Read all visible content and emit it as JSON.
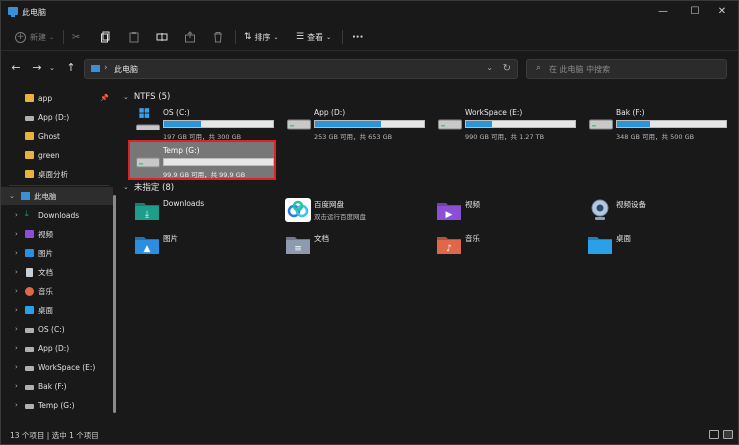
{
  "window": {
    "title": "此电脑"
  },
  "toolbar": {
    "new_label": "新建",
    "sort_label": "排序",
    "view_label": "查看",
    "more_label": "···"
  },
  "nav": {
    "back": "←",
    "forward": "→",
    "up": "↑",
    "path": "此电脑"
  },
  "search": {
    "placeholder": "在 此电脑 中搜索"
  },
  "sidebar": {
    "quick_access": [
      {
        "label": "app",
        "icon": "folder-icon",
        "pinned": true
      },
      {
        "label": "App (D:)",
        "icon": "drive-icon"
      },
      {
        "label": "Ghost",
        "icon": "folder-icon"
      },
      {
        "label": "green",
        "icon": "folder-icon"
      },
      {
        "label": "桌面分析",
        "icon": "folder-icon"
      }
    ],
    "this_pc": {
      "label": "此电脑"
    },
    "pc_items": [
      {
        "label": "Downloads",
        "icon": "download-icon"
      },
      {
        "label": "视频",
        "icon": "video-icon"
      },
      {
        "label": "图片",
        "icon": "picture-icon"
      },
      {
        "label": "文档",
        "icon": "document-icon"
      },
      {
        "label": "音乐",
        "icon": "music-icon"
      },
      {
        "label": "桌面",
        "icon": "desktop-icon"
      },
      {
        "label": "OS (C:)",
        "icon": "drive-icon"
      },
      {
        "label": "App (D:)",
        "icon": "drive-icon"
      },
      {
        "label": "WorkSpace (E:)",
        "icon": "drive-icon"
      },
      {
        "label": "Bak (F:)",
        "icon": "drive-icon"
      },
      {
        "label": "Temp (G:)",
        "icon": "drive-icon"
      }
    ]
  },
  "content": {
    "ntfs_header": "NTFS (5)",
    "drives": [
      {
        "name": "OS (C:)",
        "info": "197 GB 可用，共 300 GB",
        "used": 0.34,
        "windows": true
      },
      {
        "name": "App (D:)",
        "info": "253 GB 可用，共 653 GB",
        "used": 0.61
      },
      {
        "name": "WorkSpace (E:)",
        "info": "990 GB 可用，共 1.27 TB",
        "used": 0.24
      },
      {
        "name": "Bak (F:)",
        "info": "348 GB 可用，共 500 GB",
        "used": 0.3
      },
      {
        "name": "Temp (G:)",
        "info": "99.9 GB 可用，共 99.9 GB",
        "used": 0.0,
        "selected": true
      }
    ],
    "unspecified_header": "未指定 (8)",
    "folders": [
      {
        "name": "Downloads",
        "sub": "",
        "icon": "download-folder-icon",
        "color": "#1e9e8a"
      },
      {
        "name": "百度网盘",
        "sub": "双击运行百度网盘",
        "icon": "baidu-netdisk-icon",
        "color": "#ffffff"
      },
      {
        "name": "视频",
        "sub": "",
        "icon": "video-folder-icon",
        "color": "#8a4fd4"
      },
      {
        "name": "视频设备",
        "sub": "",
        "icon": "webcam-icon",
        "color": "#8aa6c8"
      },
      {
        "name": "图片",
        "sub": "",
        "icon": "picture-folder-icon",
        "color": "#2a8fe0"
      },
      {
        "name": "文档",
        "sub": "",
        "icon": "document-folder-icon",
        "color": "#8d9bb0"
      },
      {
        "name": "音乐",
        "sub": "",
        "icon": "music-folder-icon",
        "color": "#e0684a"
      },
      {
        "name": "桌面",
        "sub": "",
        "icon": "desktop-folder-icon",
        "color": "#2aa0e8"
      }
    ]
  },
  "status": {
    "text": "13 个项目  |  选中 1 个项目"
  }
}
